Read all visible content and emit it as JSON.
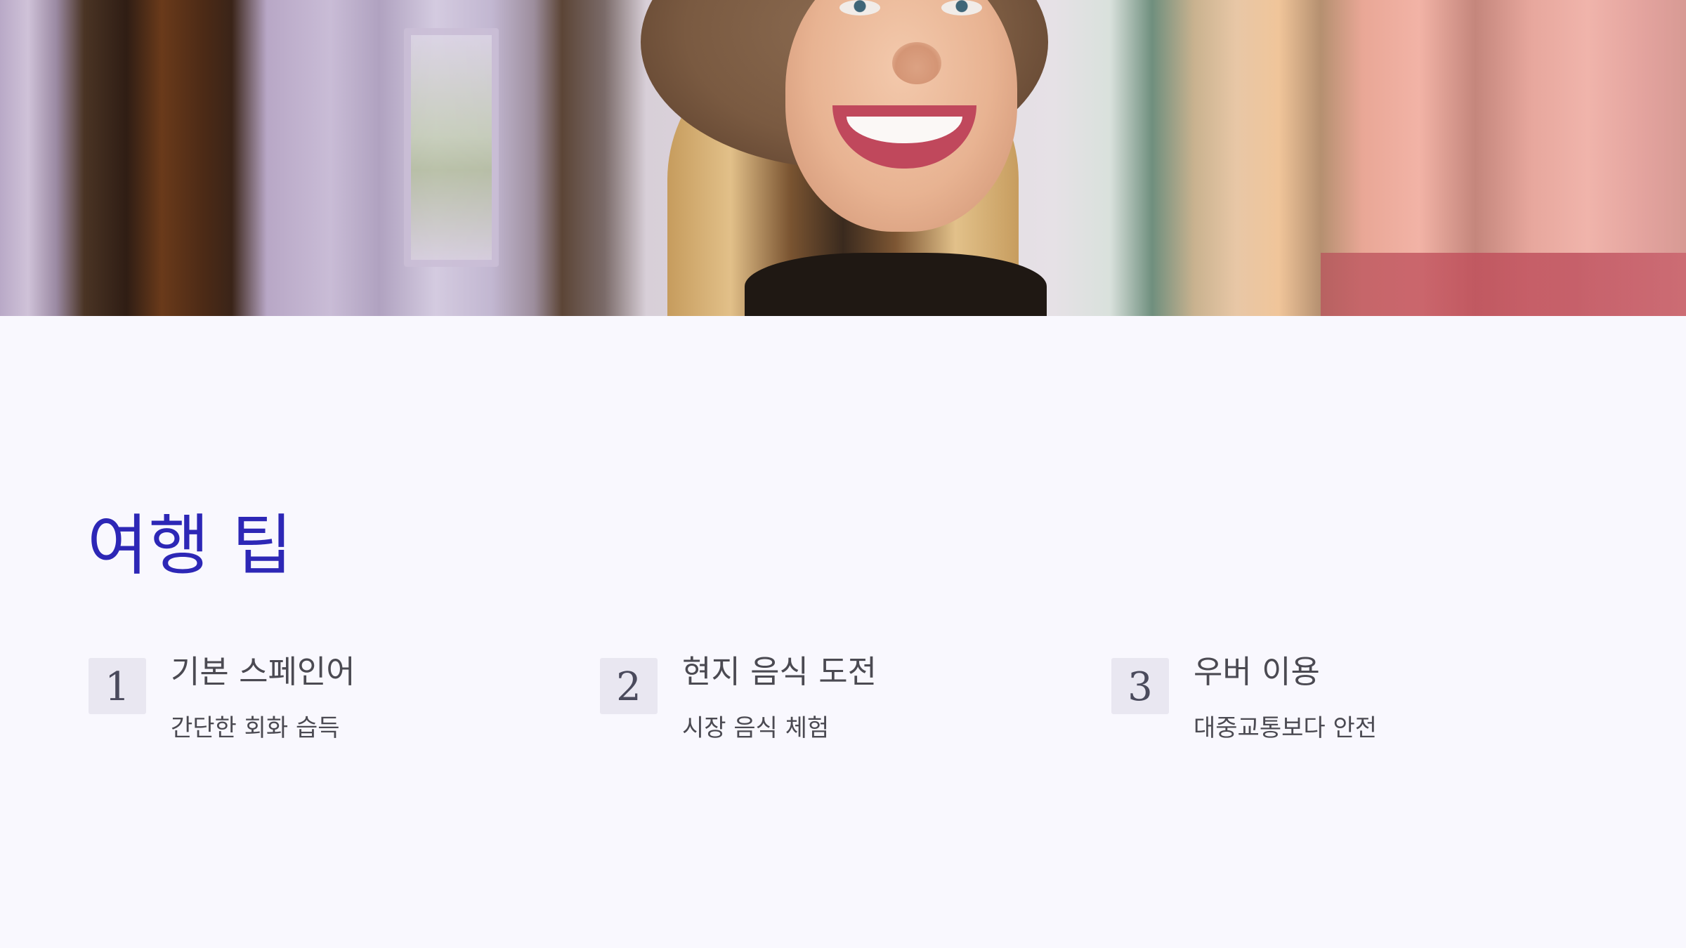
{
  "hero": {
    "image_icon": "photo-smiling-woman-in-hat"
  },
  "page": {
    "title": "여행 팁"
  },
  "tips": [
    {
      "number": "1",
      "title": "기본 스페인어",
      "description": "간단한 회화 습득"
    },
    {
      "number": "2",
      "title": "현지 음식 도전",
      "description": "시장 음식 체험"
    },
    {
      "number": "3",
      "title": "우버 이용",
      "description": "대중교통보다 안전"
    }
  ],
  "colors": {
    "title": "#2d27b6",
    "background": "#f9f8fe",
    "number_box": "#e9e7f1",
    "body_text": "#4b4a52"
  }
}
